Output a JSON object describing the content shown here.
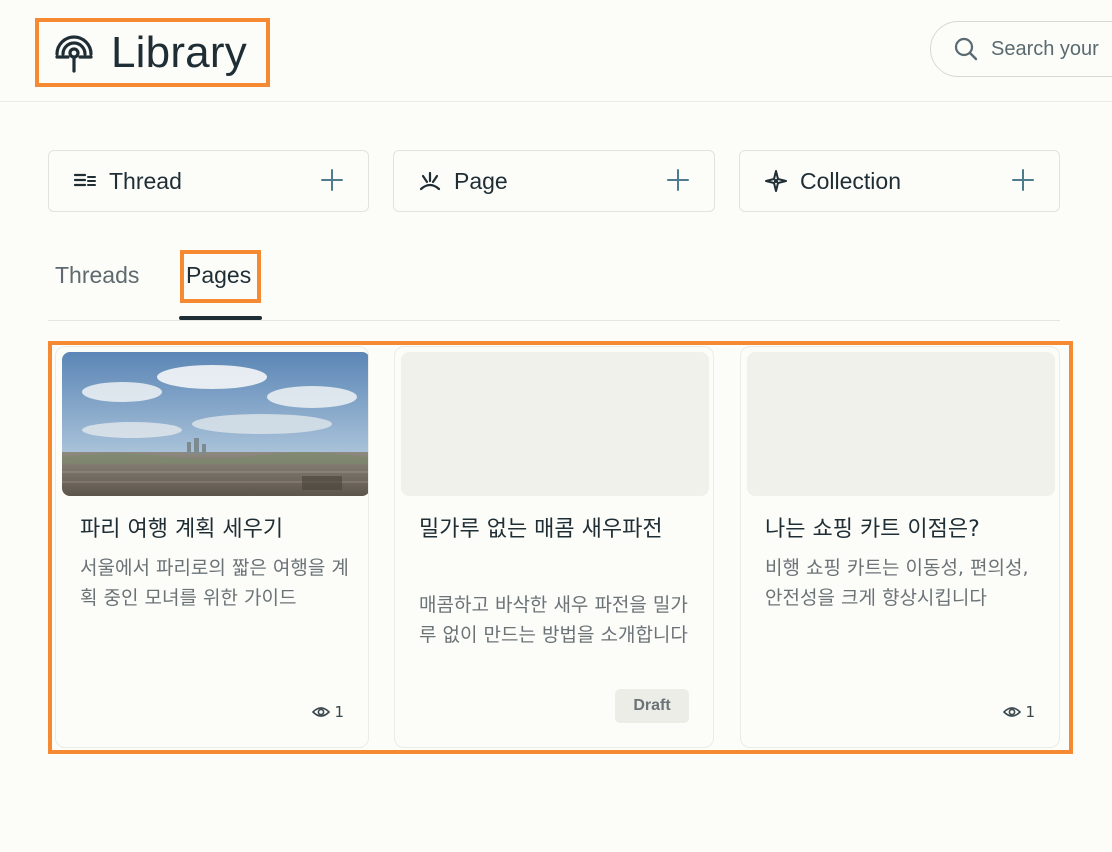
{
  "header": {
    "title": "Library",
    "search_placeholder": "Search your"
  },
  "create": [
    {
      "label": "Thread",
      "icon": "thread-icon"
    },
    {
      "label": "Page",
      "icon": "page-icon"
    },
    {
      "label": "Collection",
      "icon": "collection-icon"
    }
  ],
  "tabs": {
    "threads": "Threads",
    "pages": "Pages",
    "active": "pages"
  },
  "cards": [
    {
      "title": "파리 여행 계획 세우기",
      "description": "서울에서 파리로의 짧은 여행을 계획 중인 모녀를 위한 가이드",
      "has_image": true,
      "views": "1"
    },
    {
      "title": "밀가루 없는 매콤 새우파전",
      "description": "매콤하고 바삭한 새우 파전을 밀가루 없이 만드는 방법을 소개합니다",
      "has_image": false,
      "badge": "Draft"
    },
    {
      "title": "나는 쇼핑 카트 이점은?",
      "description": "비행 쇼핑 카트는 이동성, 편의성, 안전성을 크게 향상시킵니다",
      "has_image": false,
      "views": "1"
    }
  ],
  "colors": {
    "accent_highlight": "#f58a33",
    "text_primary": "#1f2e35",
    "text_muted": "#6b7377",
    "plus_icon": "#4d7d8c",
    "background": "#fcfcf9"
  }
}
